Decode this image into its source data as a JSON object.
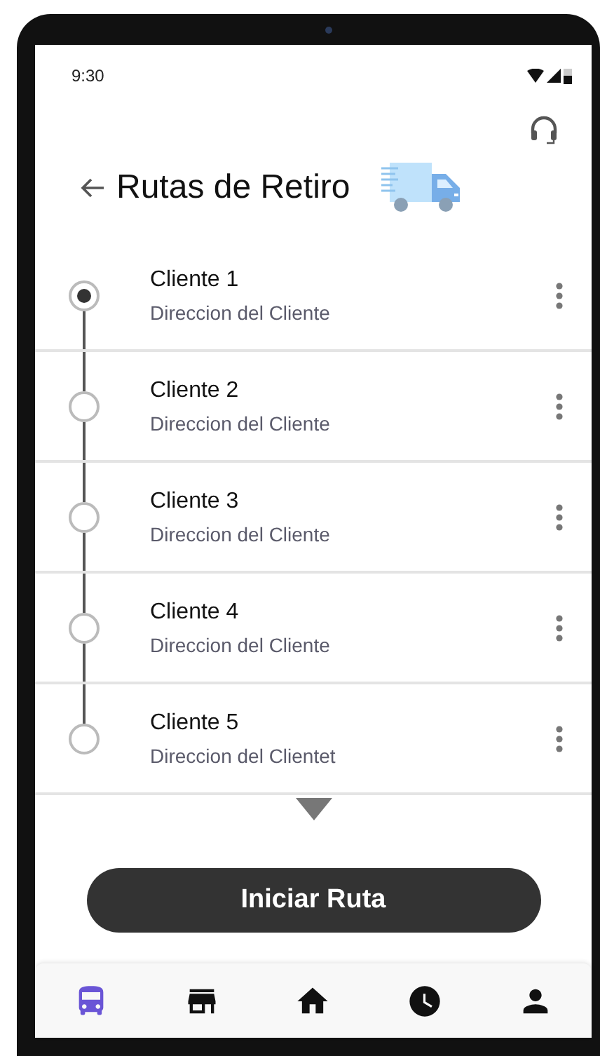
{
  "status_bar": {
    "time": "9:30"
  },
  "header": {
    "title": "Rutas de Retiro"
  },
  "clients": [
    {
      "name": "Cliente 1",
      "address": "Direccion del Cliente",
      "selected": true
    },
    {
      "name": "Cliente 2",
      "address": "Direccion del Cliente",
      "selected": false
    },
    {
      "name": "Cliente 3",
      "address": "Direccion del Cliente",
      "selected": false
    },
    {
      "name": "Cliente 4",
      "address": "Direccion del Cliente",
      "selected": false
    },
    {
      "name": "Cliente 5",
      "address": "Direccion del Clientet",
      "selected": false
    }
  ],
  "start_button": {
    "label": "Iniciar Ruta"
  },
  "bottom_nav": [
    {
      "kind": "bus",
      "selected": true
    },
    {
      "kind": "store",
      "selected": false
    },
    {
      "kind": "home",
      "selected": false
    },
    {
      "kind": "clock",
      "selected": false
    },
    {
      "kind": "person",
      "selected": false
    }
  ]
}
